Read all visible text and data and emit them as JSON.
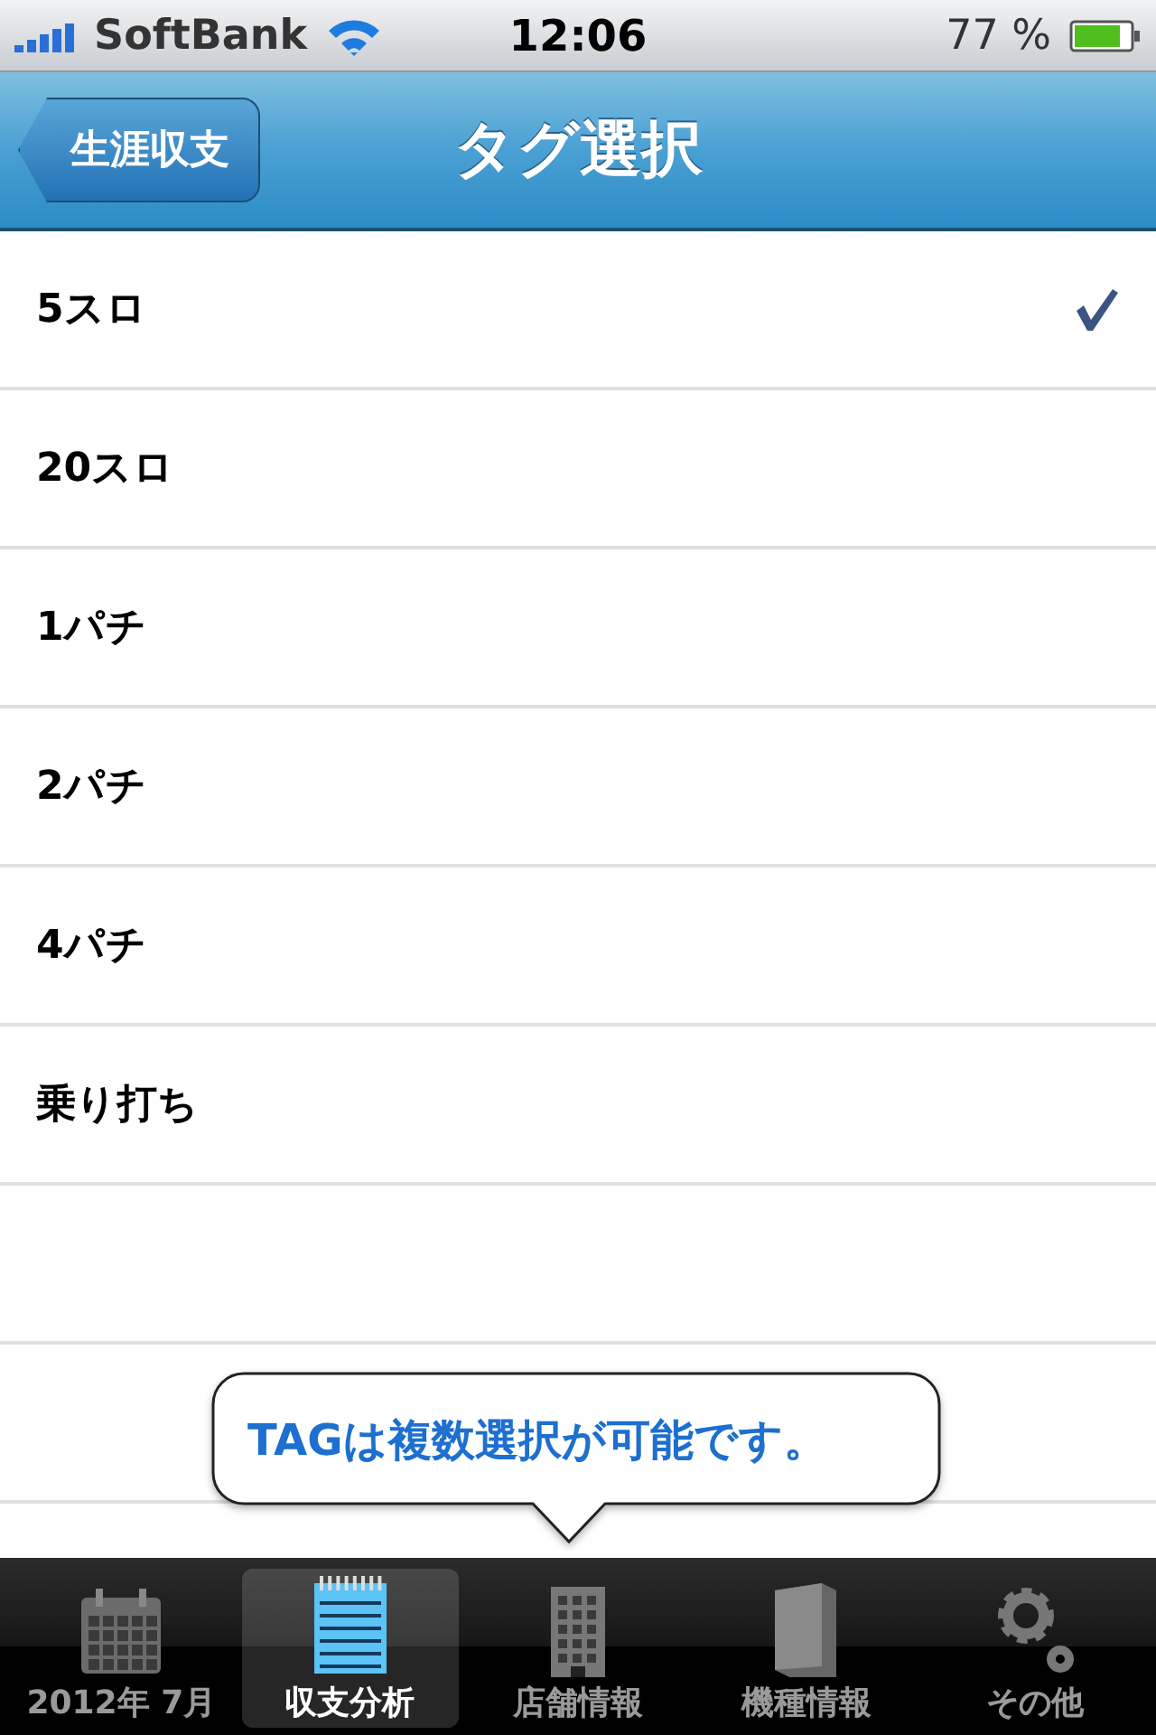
{
  "status_bar": {
    "carrier": "SoftBank",
    "time": "12:06",
    "battery": "77 %"
  },
  "nav_bar": {
    "back": "生涯収支",
    "title": "タグ選択"
  },
  "tags": [
    {
      "label": "5スロ",
      "selected": true
    },
    {
      "label": "20スロ",
      "selected": false
    },
    {
      "label": "1パチ",
      "selected": false
    },
    {
      "label": "2パチ",
      "selected": false
    },
    {
      "label": "4パチ",
      "selected": false
    },
    {
      "label": "乗り打ち",
      "selected": false
    }
  ],
  "tooltip": "TAGは複数選択が可能です。",
  "tab_bar": [
    {
      "kind": "calendar",
      "label": "2012年 7月",
      "selected": false
    },
    {
      "kind": "notepad",
      "label": "収支分析",
      "selected": true
    },
    {
      "kind": "building",
      "label": "店舗情報",
      "selected": false
    },
    {
      "kind": "book",
      "label": "機種情報",
      "selected": false
    },
    {
      "kind": "gear",
      "label": "その他",
      "selected": false
    }
  ]
}
